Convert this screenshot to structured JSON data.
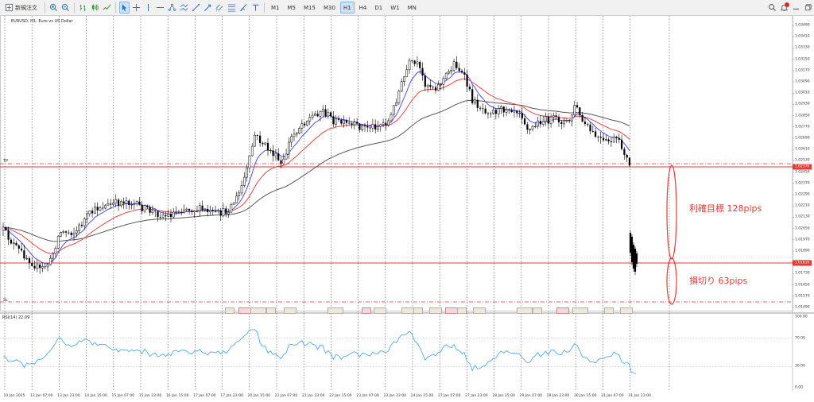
{
  "toolbar": {
    "new_order_label": "新規注文",
    "timeframes": [
      "M1",
      "M5",
      "M15",
      "M30",
      "H1",
      "H4",
      "D1",
      "W1",
      "MN"
    ],
    "active_timeframe": "H1"
  },
  "chart": {
    "title": "EURUSD, H1: Euro vs US Dollar",
    "tp_tag": "TP",
    "sl_tag": "SL",
    "annot_tp": "利確目標 128pips",
    "annot_sl": "損切り 63pips",
    "rsi_title": "RSI(14) 22.09",
    "price_labels": [
      "1.03490",
      "1.03410",
      "1.03330",
      "1.03250",
      "1.03170",
      "1.03090",
      "1.03010",
      "1.02930",
      "1.02850",
      "1.02770",
      "1.02690",
      "1.02610",
      "1.02530",
      "1.02450",
      "1.02370",
      "1.02290",
      "1.02210",
      "1.02130",
      "1.02050",
      "1.01970",
      "1.01890",
      "1.01810",
      "1.01730",
      "1.01650",
      "1.01570",
      "1.01490"
    ],
    "price_highlight_top": "1.02370",
    "price_highlight_bottom": "1.01810",
    "rsi_labels": [
      "100.00",
      "70.00",
      "30.00",
      "0.00"
    ],
    "time_labels": [
      "10 Jan 2025",
      "13 Jan 07:00",
      "13 Jan 23:00",
      "14 Jan 15:00",
      "15 Jan 07:00",
      "15 Jan 23:00",
      "16 Jan 15:00",
      "17 Jan 07:00",
      "17 Jan 23:00",
      "20 Jan 15:00",
      "21 Jan 07:00",
      "21 Jan 23:00",
      "22 Jan 15:00",
      "23 Jan 07:00",
      "23 Jan 23:00",
      "24 Jan 15:00",
      "27 Jan 07:00",
      "27 Jan 23:00",
      "28 Jan 15:00",
      "29 Jan 07:00",
      "29 Jan 23:00",
      "30 Jan 15:00",
      "31 Jan 07:00",
      "31 Jan 23:00"
    ]
  },
  "colors": {
    "candle": "#000000",
    "ema_fast": "#4c4cf5",
    "ema_mid": "#e84545",
    "sma_slow": "#555555",
    "rsi": "#52a8e8",
    "level_red": "#e53935",
    "annotation": "#e53935"
  },
  "chart_data": {
    "type": "candlestick",
    "symbol": "EURUSD",
    "timeframe": "H1",
    "ylim": [
      1.0149,
      1.0349
    ],
    "rsi_levels": [
      70,
      30
    ],
    "rsi_range": [
      0,
      100
    ]
  }
}
